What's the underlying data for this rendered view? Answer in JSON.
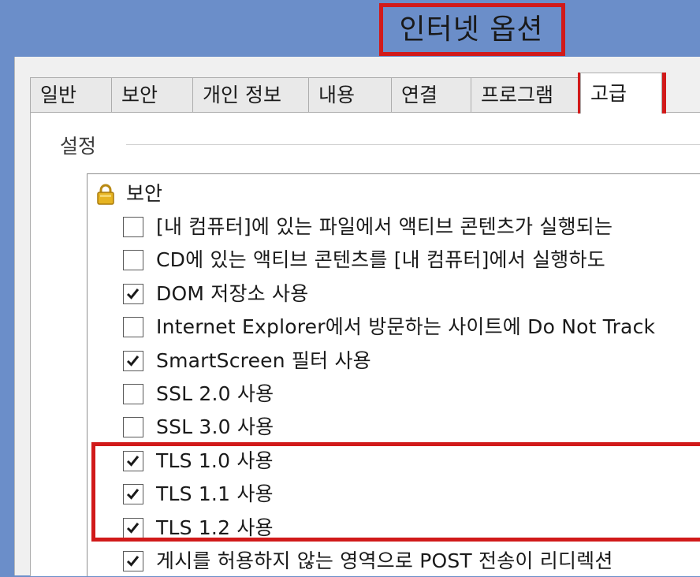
{
  "window": {
    "title": "인터넷 옵션"
  },
  "tabs": [
    {
      "label": "일반",
      "active": false
    },
    {
      "label": "보안",
      "active": false
    },
    {
      "label": "개인 정보",
      "active": false
    },
    {
      "label": "내용",
      "active": false
    },
    {
      "label": "연결",
      "active": false
    },
    {
      "label": "프로그램",
      "active": false
    },
    {
      "label": "고급",
      "active": true
    }
  ],
  "settings": {
    "group_label": "설정",
    "category": {
      "label": "보안",
      "icon": "lock-icon"
    },
    "items": [
      {
        "label": "[내 컴퓨터]에 있는 파일에서 액티브 콘텐츠가 실행되는",
        "checked": false
      },
      {
        "label": "CD에 있는 액티브 콘텐츠를 [내 컴퓨터]에서 실행하도",
        "checked": false
      },
      {
        "label": "DOM 저장소 사용",
        "checked": true
      },
      {
        "label": "Internet Explorer에서 방문하는 사이트에 Do Not Track",
        "checked": false
      },
      {
        "label": "SmartScreen 필터 사용",
        "checked": true
      },
      {
        "label": "SSL 2.0 사용",
        "checked": false
      },
      {
        "label": "SSL 3.0 사용",
        "checked": false
      },
      {
        "label": "TLS 1.0 사용",
        "checked": true
      },
      {
        "label": "TLS 1.1 사용",
        "checked": true
      },
      {
        "label": "TLS 1.2 사용",
        "checked": true
      },
      {
        "label": "게시를 허용하지 않는 영역으로 POST 전송이 리디렉션",
        "checked": true
      }
    ]
  },
  "colors": {
    "title_bar": "#6b8ec9",
    "highlight": "#d11a1a"
  }
}
